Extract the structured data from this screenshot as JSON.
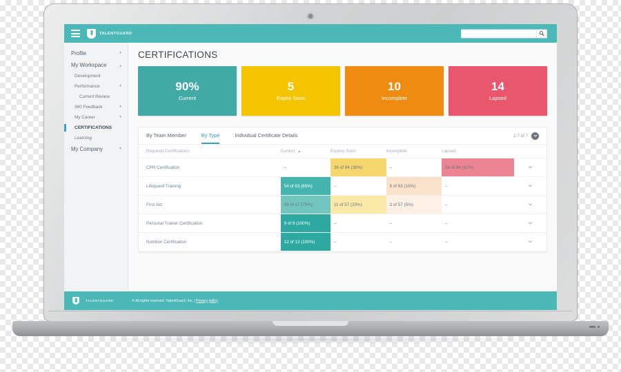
{
  "appbar": {
    "brand": "TALENTGUARD",
    "menu_icon": "hamburger-icon",
    "search_placeholder": "",
    "search_value": "",
    "search_icon": "search-icon"
  },
  "sidebar": {
    "items": [
      {
        "label": "Profile",
        "level": "top",
        "caret": "down",
        "active": false
      },
      {
        "label": "My Workspace",
        "level": "top",
        "caret": "up",
        "active": false
      },
      {
        "label": "Development",
        "level": "sub",
        "caret": "",
        "active": false
      },
      {
        "label": "Performance",
        "level": "sub",
        "caret": "down",
        "active": false
      },
      {
        "label": "Current Review",
        "level": "sub2",
        "caret": "",
        "active": false
      },
      {
        "label": "360 Feedback",
        "level": "sub",
        "caret": "down",
        "active": false
      },
      {
        "label": "My Career",
        "level": "sub",
        "caret": "down",
        "active": false
      },
      {
        "label": "CERTIFICATIONS",
        "level": "sub",
        "caret": "",
        "active": true
      },
      {
        "label": "Learning",
        "level": "sub",
        "caret": "",
        "active": false
      },
      {
        "label": "My Company",
        "level": "top",
        "caret": "down",
        "active": false
      }
    ]
  },
  "main": {
    "page_title": "CERTIFICATIONS",
    "kpis": [
      {
        "value": "90%",
        "caption": "Current",
        "color": "#41aaa5"
      },
      {
        "value": "5",
        "caption": "Expire Soon",
        "color": "#f5c400"
      },
      {
        "value": "10",
        "caption": "Incomplete",
        "color": "#ef8b10"
      },
      {
        "value": "14",
        "caption": "Lapsed",
        "color": "#e8576b"
      }
    ],
    "tabs": [
      {
        "label": "By Team Member",
        "active": false
      },
      {
        "label": "By Type",
        "active": true
      },
      {
        "label": "Individual Certificate Details",
        "active": false
      }
    ],
    "pager": {
      "text": "1-7 of 7",
      "icon": "chevron-down-circle-icon"
    },
    "table": {
      "columns": [
        "Required Certifications",
        "Current",
        "Expires Soon",
        "Incomplete",
        "Lapsed"
      ],
      "sorted_column": "Current",
      "sort_direction": "asc",
      "dash": "–",
      "row_expand_icon": "chevron-down-icon",
      "rows": [
        {
          "name": "CPR Certification",
          "current": "–",
          "current_bg": "",
          "expires": "36 of 94 (38%)",
          "expires_bg": "#f5d76e",
          "incomplete": "–",
          "incomplete_bg": "",
          "lapsed": "58 of 94 (62%)",
          "lapsed_bg": "#ed8493"
        },
        {
          "name": "Lifeguard Training",
          "current": "54 of 63 (85%)",
          "current_bg": "#43b5ae",
          "expires": "–",
          "expires_bg": "",
          "incomplete": "9 of 63 (15%)",
          "incomplete_bg": "#fae2cb",
          "lapsed": "–",
          "lapsed_bg": ""
        },
        {
          "name": "First Aid",
          "current": "43 of 57 (75%)",
          "current_bg": "#72c6bf",
          "expires": "11 of 57 (20%)",
          "expires_bg": "#fbe9a8",
          "incomplete": "3 of 57 (5%)",
          "incomplete_bg": "#fdf1e6",
          "lapsed": "–",
          "lapsed_bg": ""
        },
        {
          "name": "Personal Trainer Certification",
          "current": "9 of 9 (100%)",
          "current_bg": "#2ea9a1",
          "expires": "–",
          "expires_bg": "",
          "incomplete": "–",
          "incomplete_bg": "",
          "lapsed": "–",
          "lapsed_bg": ""
        },
        {
          "name": "Nutrition Certification",
          "current": "12 of 12 (100%)",
          "current_bg": "#2ea9a1",
          "expires": "–",
          "expires_bg": "",
          "incomplete": "–",
          "incomplete_bg": "",
          "lapsed": "–",
          "lapsed_bg": ""
        }
      ]
    }
  },
  "footer": {
    "brand": "TALENTGUARD",
    "copyright": "© All rights reserved. TalentGuard, Inc. | ",
    "privacy_label": "Privacy policy"
  }
}
